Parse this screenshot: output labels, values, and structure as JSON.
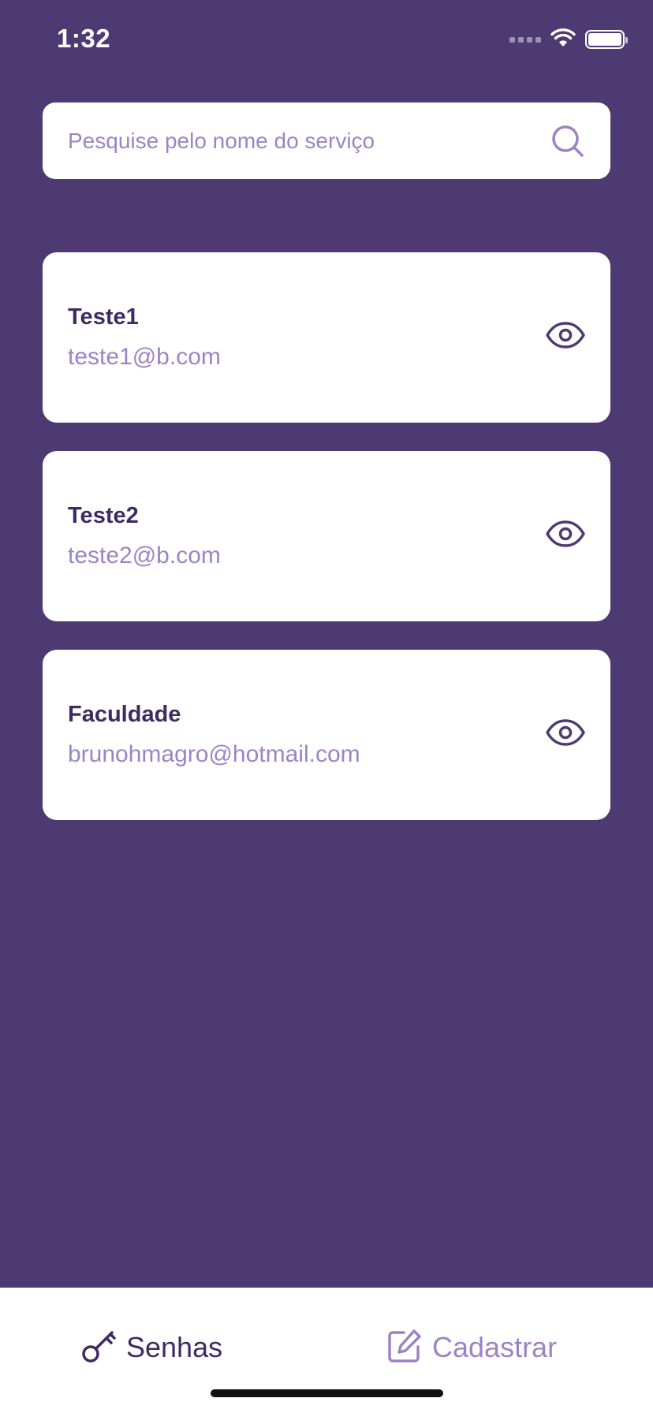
{
  "status_bar": {
    "time": "1:32"
  },
  "search": {
    "placeholder": "Pesquise pelo nome do serviço",
    "value": ""
  },
  "cards": [
    {
      "title": "Teste1",
      "email": "teste1@b.com"
    },
    {
      "title": "Teste2",
      "email": "teste2@b.com"
    },
    {
      "title": "Faculdade",
      "email": "brunohmagro@hotmail.com"
    }
  ],
  "tab_bar": {
    "senhas_label": "Senhas",
    "cadastrar_label": "Cadastrar",
    "active": "Senhas"
  },
  "colors": {
    "background": "#4e3a73",
    "card": "#ffffff",
    "title_text": "#3d2b63",
    "secondary_text": "#9b84c6"
  },
  "icons": {
    "search": "search-icon",
    "view": "eye-icon",
    "senhas": "key-icon",
    "cadastrar": "edit-icon"
  }
}
